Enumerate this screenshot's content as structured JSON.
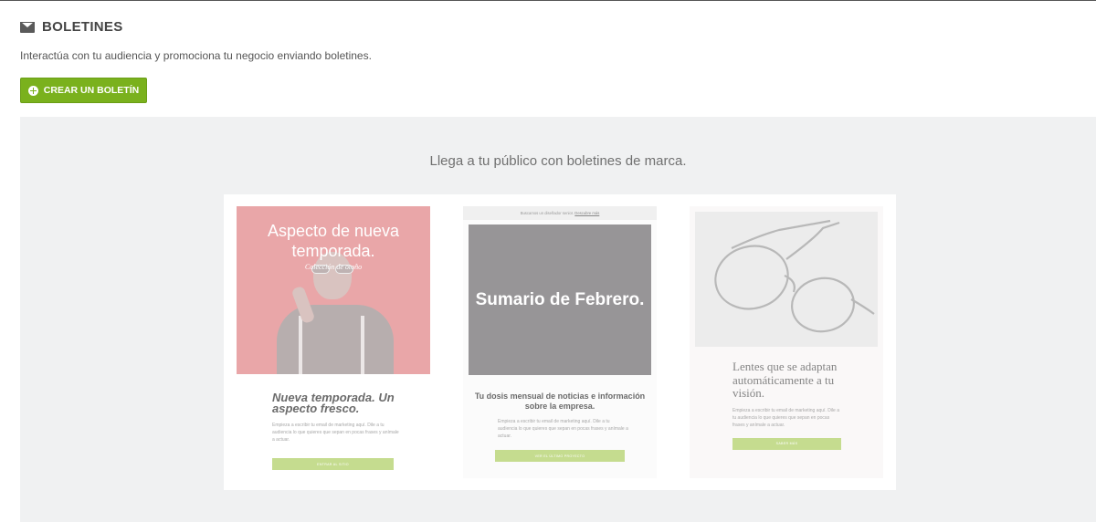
{
  "header": {
    "title": "BOLETINES",
    "icon": "envelope-icon"
  },
  "subtitle": "Interactúa con tu audiencia y promociona tu negocio enviando boletines.",
  "create_button": {
    "label": "CREAR UN BOLETÍN",
    "icon": "plus-circle-icon",
    "color": "#7ab11d"
  },
  "panel": {
    "title": "Llega a tu público con boletines de marca."
  },
  "templates": [
    {
      "hero_headline": "Aspecto de nueva temporada.",
      "hero_sub": "Colección de otoño",
      "headline": "Nueva temporada. Un aspecto fresco.",
      "body": "Empieza a escribir tu email de marketing aquí. Dile a tu audiencia lo que quieres que sepan en pocas frases y anímale a actuar.",
      "button": "ENTRAR AL SITIO",
      "hero_color": "#e9a6a8"
    },
    {
      "topbar": "Buscamos un diseñador senior.",
      "topbar_link": "Descubre más",
      "hero_headline": "Sumario de Febrero.",
      "headline": "Tu dosis mensual de noticias e información sobre la empresa.",
      "body": "Empieza a escribir tu email de marketing aquí. Dile a tu audiencia lo que quieres que sepan en pocas frases y anímale a actuar.",
      "button": "VER EL ÚLTIMO PROYECTO",
      "hero_color": "#979597"
    },
    {
      "headline": "Lentes que se adaptan automáticamente a tu visión.",
      "body": "Empieza a escribir tu email de marketing aquí. Dile a tu audiencia lo que quieres que sepan en pocas frases y anímale a actuar.",
      "button": "SABER MÁS"
    }
  ]
}
